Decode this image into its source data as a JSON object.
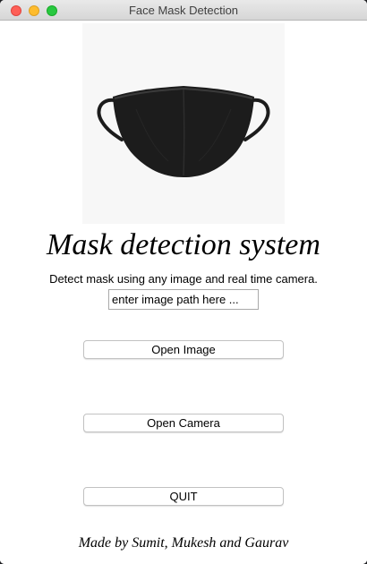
{
  "window": {
    "title": "Face Mask Detection"
  },
  "main": {
    "heading": "Mask detection system",
    "subtitle": "Detect mask using any image and real time camera.",
    "path_input": {
      "value": "",
      "placeholder": "enter image path here ..."
    },
    "buttons": {
      "open_image": "Open Image",
      "open_camera": "Open Camera",
      "quit": "QUIT"
    },
    "credits": "Made by Sumit, Mukesh and Gaurav"
  },
  "colors": {
    "close": "#fe5f57",
    "minimize": "#febc2e",
    "maximize": "#28c840",
    "mask": "#1c1c1c",
    "image_background": "#f7f7f7"
  },
  "icons": [
    "close-icon",
    "minimize-icon",
    "maximize-icon",
    "face-mask-image"
  ]
}
